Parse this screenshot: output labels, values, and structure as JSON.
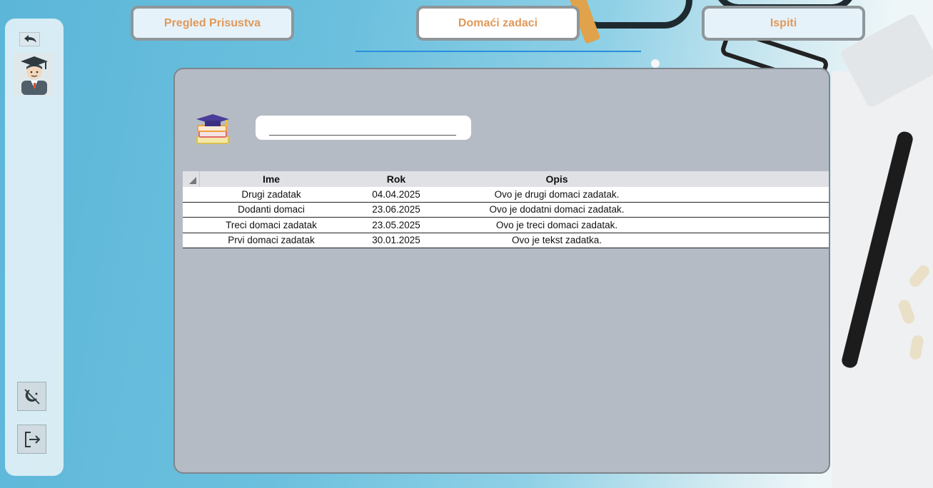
{
  "tabs": [
    {
      "label": "Pregled Prisustva",
      "active": false
    },
    {
      "label": "Domaći zadaci",
      "active": true
    },
    {
      "label": "Ispiti",
      "active": false
    }
  ],
  "sidebar": {
    "icons": [
      "undo-icon",
      "student-avatar-icon",
      "theme-toggle-icon",
      "logout-icon"
    ]
  },
  "search": {
    "value": "",
    "placeholder": ""
  },
  "table": {
    "columns": [
      "Ime",
      "Rok",
      "Opis"
    ],
    "rows": [
      [
        "Drugi zadatak",
        "04.04.2025",
        "Ovo je drugi domaci zadatak."
      ],
      [
        "Dodanti domaci",
        "23.06.2025",
        "Ovo je dodatni domaci zadatak."
      ],
      [
        "Treci domaci zadatak",
        "23.05.2025",
        "Ovo je treci domaci zadatak."
      ],
      [
        "Prvi domaci zadatak",
        "30.01.2025",
        "Ovo je tekst zadatka."
      ]
    ]
  },
  "colors": {
    "tab_text": "#e0995a",
    "panel_bg": "#b5bbc5",
    "underline": "#2a8fdc"
  }
}
